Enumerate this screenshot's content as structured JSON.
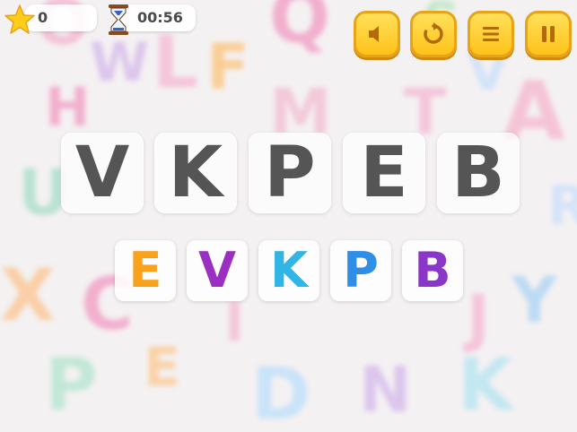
{
  "hud": {
    "score": "0",
    "timer": "00:56",
    "star_icon": "star-icon",
    "timer_icon": "hourglass-icon"
  },
  "controls": [
    {
      "name": "sound-button",
      "icon": "speaker-icon"
    },
    {
      "name": "restart-button",
      "icon": "restart-icon"
    },
    {
      "name": "menu-button",
      "icon": "menu-icon"
    },
    {
      "name": "pause-button",
      "icon": "pause-icon"
    }
  ],
  "target_word": [
    "V",
    "K",
    "P",
    "E",
    "B"
  ],
  "letter_choices": [
    {
      "letter": "E",
      "color": "#f9a21a"
    },
    {
      "letter": "V",
      "color": "#9b2fc2"
    },
    {
      "letter": "K",
      "color": "#2fb6e6"
    },
    {
      "letter": "P",
      "color": "#2f8ee6"
    },
    {
      "letter": "B",
      "color": "#8a37c9"
    }
  ],
  "colors": {
    "button": "#ffcf2a",
    "target_letter": "#555555"
  },
  "background_letters": [
    "O",
    "Q",
    "S",
    "A",
    "L",
    "F",
    "M",
    "W",
    "V",
    "X",
    "C",
    "U",
    "T",
    "H",
    "K",
    "R",
    "D",
    "I",
    "E",
    "P",
    "Y",
    "J",
    "N"
  ]
}
